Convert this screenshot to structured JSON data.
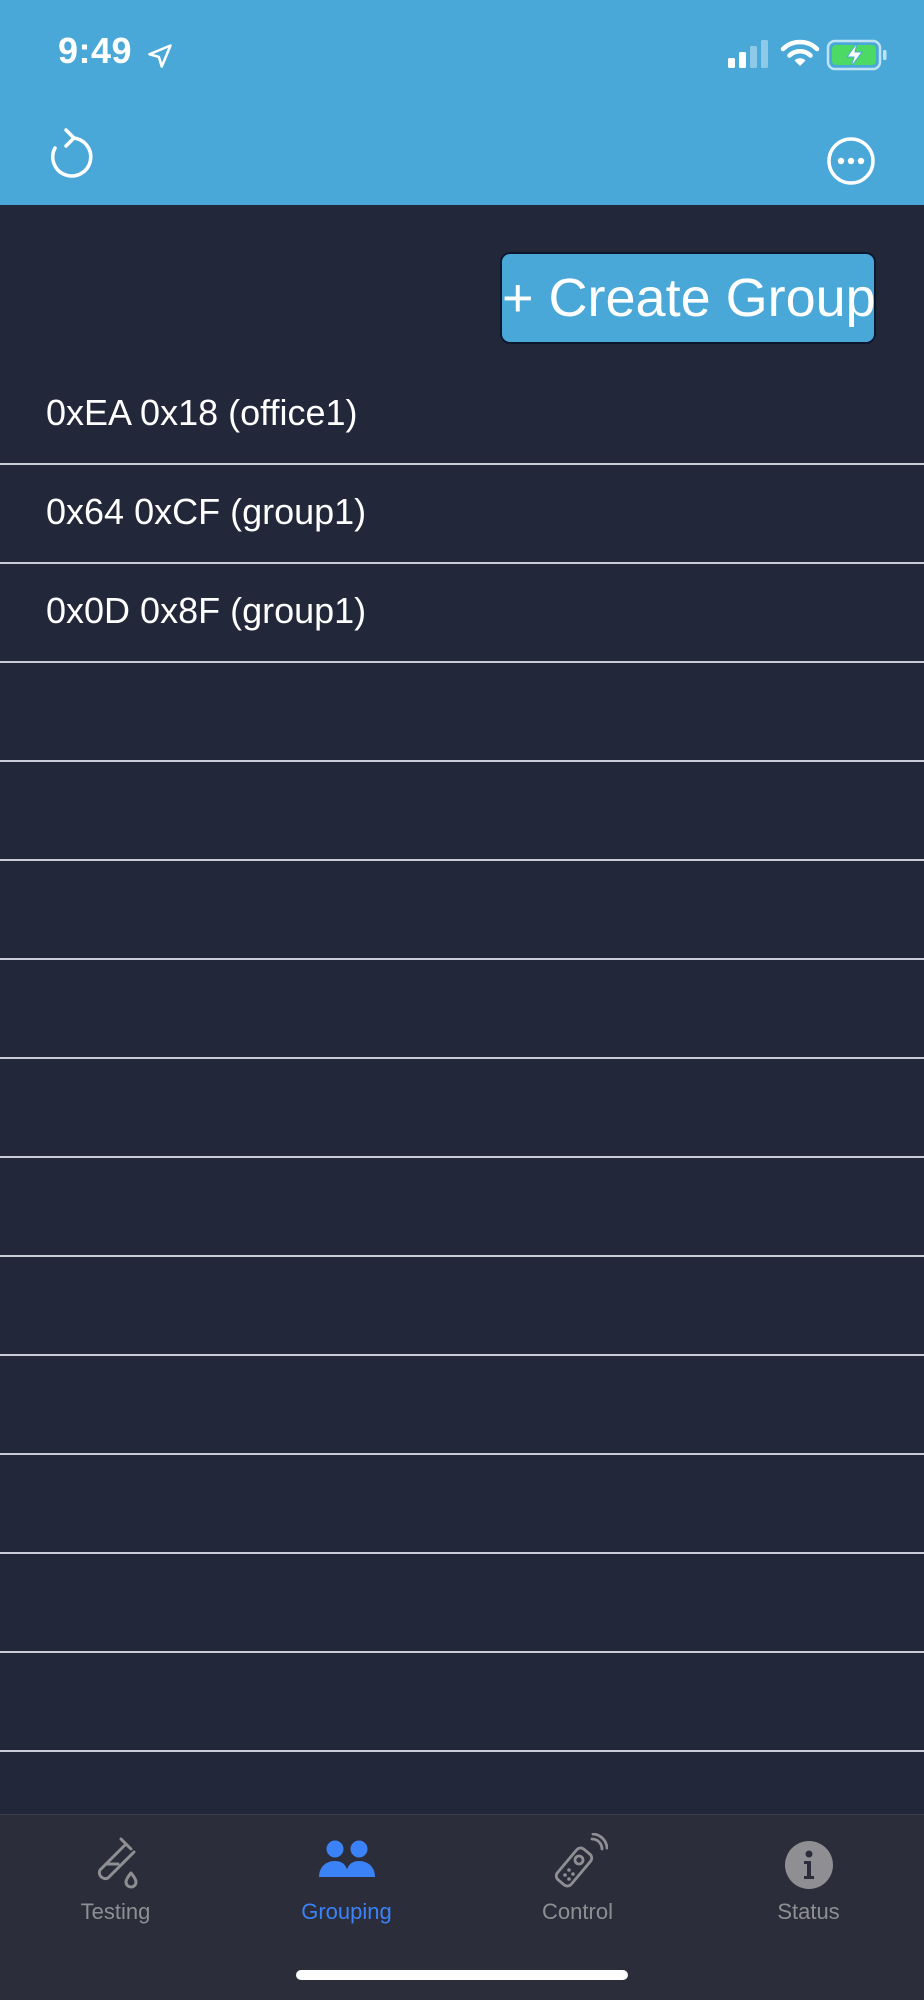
{
  "status_bar": {
    "time": "9:49",
    "icons": [
      "location-arrow-icon",
      "cellular-signal-icon",
      "wifi-icon",
      "battery-charging-icon"
    ]
  },
  "nav_bar": {
    "left_icon": "refresh-icon",
    "right_icon": "more-options-icon"
  },
  "actions": {
    "create_group_label": "+ Create Group"
  },
  "groups": [
    "0xEA 0x18 (office1)",
    "0x64 0xCF (group1)",
    "0x0D 0x8F (group1)",
    "",
    "",
    "",
    "",
    "",
    "",
    "",
    "",
    "",
    "",
    "",
    ""
  ],
  "tabs": [
    {
      "label": "Testing",
      "icon": "test-tube-icon",
      "active": false
    },
    {
      "label": "Grouping",
      "icon": "people-icon",
      "active": true
    },
    {
      "label": "Control",
      "icon": "remote-control-icon",
      "active": false
    },
    {
      "label": "Status",
      "icon": "info-icon",
      "active": false
    }
  ],
  "colors": {
    "header": "#4aa8d8",
    "background": "#23273a",
    "tab_bar": "#2b2d3a",
    "active_tab": "#3b82f6",
    "inactive_tab": "#8e8e93",
    "divider": "#c9ccd6"
  }
}
